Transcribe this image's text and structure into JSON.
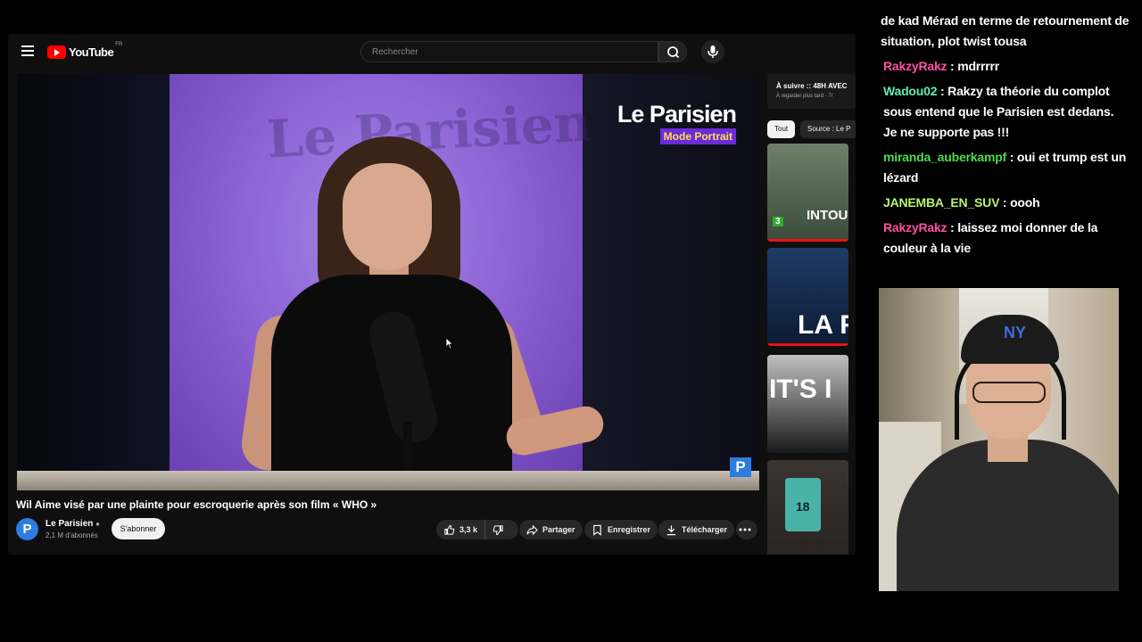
{
  "youtube": {
    "brand": "YouTube",
    "country": "FR",
    "search_placeholder": "Rechercher",
    "video": {
      "watermark": "Le Parisien",
      "brand_name": "Le Parisien",
      "brand_tag": "Mode Portrait",
      "corner_mark": "P",
      "title": "Wil Aime visé par une plainte pour escroquerie après son film « WHO »"
    },
    "channel": {
      "avatar_letter": "P",
      "name": "Le Parisien",
      "subscribers": "2,1 M d'abonnés",
      "subscribe_label": "S'abonner"
    },
    "actions": {
      "likes": "3,3 k",
      "share": "Partager",
      "save": "Enregistrer",
      "download": "Télécharger"
    },
    "sidebar": {
      "banner_line1": "À suivre :: 48H AVEC",
      "banner_line2": "À regarder plus tard - 7/",
      "chips": [
        "Tout",
        "Source : Le P"
      ],
      "thumbnails": [
        {
          "caption": "INTOU",
          "badge": "3"
        },
        {
          "caption": "LA R"
        },
        {
          "caption": "IT'S I"
        },
        {
          "caption": "18"
        }
      ]
    }
  },
  "chat": [
    {
      "user": "",
      "color": "#ffffff",
      "text": "de kad Mérad en terme de retournement de situation, plot twist tousa"
    },
    {
      "user": "RakzyRakz",
      "color": "#ff4fa3",
      "text": " : mdrrrrr"
    },
    {
      "user": "Wadou02",
      "color": "#5ef0b4",
      "text": " : Rakzy ta théorie du complot sous entend que le Parisien est dedans. Je ne supporte pas !!!"
    },
    {
      "user": "miranda_auberkampf",
      "color": "#4ddc4d",
      "text": " : oui et trump est un lézard"
    },
    {
      "user": "JANEMBA_EN_SUV",
      "color": "#b6f56b",
      "text": " : oooh"
    },
    {
      "user": "RakzyRakz",
      "color": "#ff4fa3",
      "text": " : laissez moi donner de la couleur à la vie"
    }
  ],
  "webcam": {
    "cap_logo": "NY"
  }
}
